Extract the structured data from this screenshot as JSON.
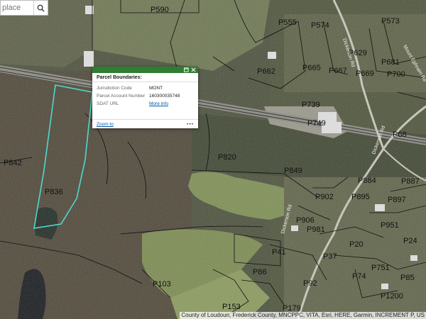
{
  "search": {
    "placeholder": "place"
  },
  "popup": {
    "title": "Parcel Boundaries:",
    "fields": [
      {
        "key": "Jurisdiction Code",
        "value": "MONT"
      },
      {
        "key": "Parcel Account Number",
        "value": "160300035748"
      },
      {
        "key": "SDAT URL",
        "value": "More info"
      }
    ],
    "zoom_label": "Zoom to",
    "more_label": "•••"
  },
  "parcels": [
    "P590",
    "P555",
    "P574",
    "P573",
    "P629",
    "P681",
    "P662",
    "P665",
    "P667",
    "P669",
    "P700",
    "P739",
    "P749",
    "P68",
    "P820",
    "P842",
    "P836",
    "P849",
    "P884",
    "P887",
    "P902",
    "P895",
    "P897",
    "P906",
    "P951",
    "P981",
    "P24",
    "P20",
    "P41",
    "P37",
    "P751",
    "P74",
    "P85",
    "P86",
    "P92",
    "P103",
    "P153",
    "P1200",
    "P179"
  ],
  "roads": [
    "Dickerson Rd",
    "Dickerson Rd",
    "Dickerson Rd",
    "Mount Ephraim Rd"
  ],
  "attribution": "County of Loudoun, Frederick County, MNCPPC, VITA, Esri, HERE, Garmin, INCREMENT P, US",
  "colors": {
    "popup_header": "#2e7d32",
    "parcel_highlight": "#4dd9d0",
    "parcel_lines": "#111111",
    "link": "#0055aa"
  }
}
